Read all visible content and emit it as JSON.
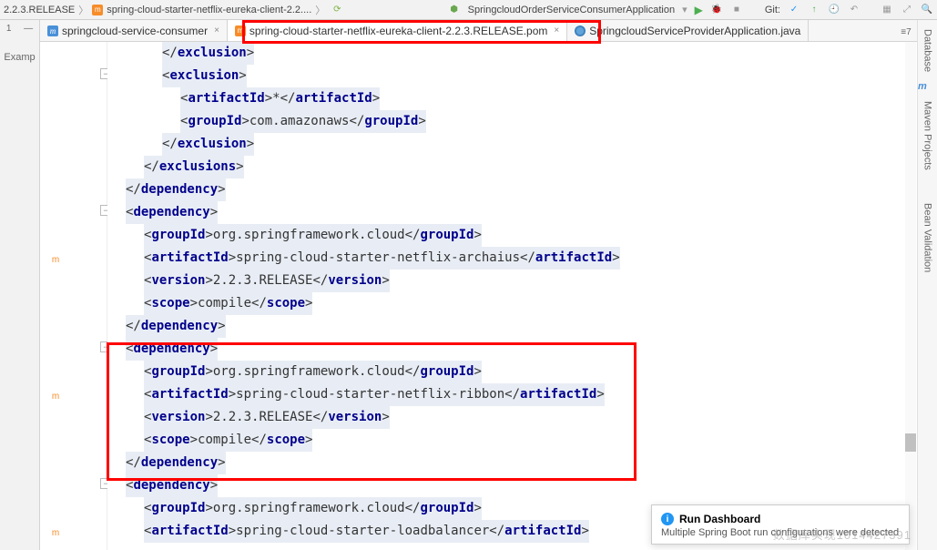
{
  "toolbar": {
    "breadcrumb1": "2.2.3.RELEASE",
    "breadcrumb2": "spring-cloud-starter-netflix-eureka-client-2.2....",
    "runconfig": "SpringcloudOrderServiceConsumerApplication",
    "git_label": "Git:"
  },
  "tabs": {
    "t1": "springcloud-service-consumer",
    "t2": "spring-cloud-starter-netflix-eureka-client-2.2.3.RELEASE.pom",
    "t3": "SpringcloudServiceProviderApplication.java"
  },
  "left_tool": {
    "label": "Examp"
  },
  "right_tools": {
    "db": "Database",
    "m": "m",
    "maven": "Maven Projects",
    "bean": "Bean Validation"
  },
  "opts": "≡7",
  "code": {
    "l1a": "</",
    "l1b": "exclusion",
    "l1c": ">",
    "l2a": "<",
    "l2b": "exclusion",
    "l2c": ">",
    "l3a": "<",
    "l3b": "artifactId",
    "l3c": ">*</",
    "l3d": "artifactId",
    "l3e": ">",
    "l4a": "<",
    "l4b": "groupId",
    "l4c": ">com.amazonaws</",
    "l4d": "groupId",
    "l4e": ">",
    "l5a": "</",
    "l5b": "exclusion",
    "l5c": ">",
    "l6a": "</",
    "l6b": "exclusions",
    "l6c": ">",
    "l7a": "</",
    "l7b": "dependency",
    "l7c": ">",
    "l8a": "<",
    "l8b": "dependency",
    "l8c": ">",
    "l9a": "<",
    "l9b": "groupId",
    "l9c": ">org.springframework.cloud</",
    "l9d": "groupId",
    "l9e": ">",
    "l10a": "<",
    "l10b": "artifactId",
    "l10c": ">spring-cloud-starter-netflix-archaius</",
    "l10d": "artifactId",
    "l10e": ">",
    "l11a": "<",
    "l11b": "version",
    "l11c": ">2.2.3.RELEASE</",
    "l11d": "version",
    "l11e": ">",
    "l12a": "<",
    "l12b": "scope",
    "l12c": ">compile</",
    "l12d": "scope",
    "l12e": ">",
    "l13a": "</",
    "l13b": "dependency",
    "l13c": ">",
    "l14a": "<",
    "l14b": "dependency",
    "l14c": ">",
    "l15a": "<",
    "l15b": "groupId",
    "l15c": ">org.springframework.cloud</",
    "l15d": "groupId",
    "l15e": ">",
    "l16a": "<",
    "l16b": "artifactId",
    "l16c": ">spring-cloud-starter-netflix-ribbon</",
    "l16d": "artifactId",
    "l16e": ">",
    "l17a": "<",
    "l17b": "version",
    "l17c": ">2.2.3.RELEASE</",
    "l17d": "version",
    "l17e": ">",
    "l18a": "<",
    "l18b": "scope",
    "l18c": ">compile</",
    "l18d": "scope",
    "l18e": ">",
    "l19a": "</",
    "l19b": "dependency",
    "l19c": ">",
    "l20a": "<",
    "l20b": "dependency",
    "l20c": ">",
    "l21a": "<",
    "l21b": "groupId",
    "l21c": ">org.springframework.cloud</",
    "l21d": "groupId",
    "l21e": ">",
    "l22a": "<",
    "l22b": "artifactId",
    "l22c": ">spring-cloud-starter-loadbalancer</",
    "l22d": "artifactId",
    "l22e": ">"
  },
  "notification": {
    "title": "Run Dashboard",
    "msg": "Multiple Spring Boot run configurations were detected"
  },
  "watermark": "数据库实现1014427391"
}
